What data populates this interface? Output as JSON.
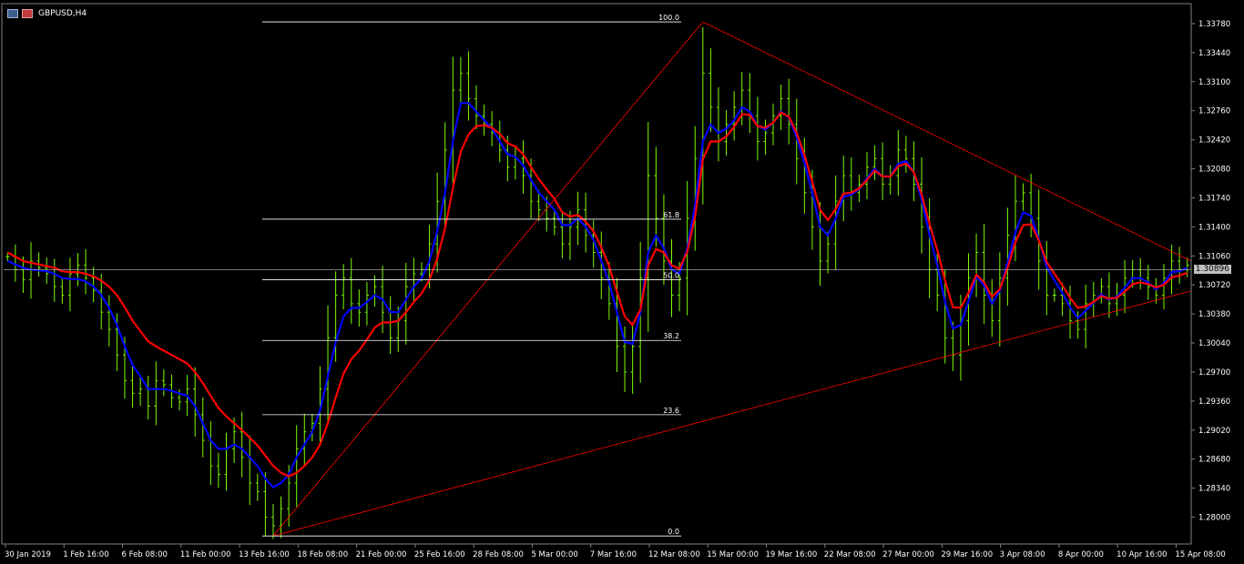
{
  "window": {
    "symbol_label": "GBPUSD,H4",
    "icons": [
      "chart-window-icon",
      "window-restore-icon"
    ]
  },
  "chart_data": {
    "type": "line",
    "style": "candlestick-bars",
    "symbol": "GBPUSD",
    "timeframe": "H4",
    "ylim": [
      1.2775,
      1.3395
    ],
    "y_ticks": [
      "1.33780",
      "1.33440",
      "1.33100",
      "1.32760",
      "1.32420",
      "1.32080",
      "1.31740",
      "1.31400",
      "1.31060",
      "1.30720",
      "1.30380",
      "1.30040",
      "1.29700",
      "1.29360",
      "1.29020",
      "1.28680",
      "1.28340",
      "1.28000"
    ],
    "x_ticks": [
      "30 Jan 2019",
      "1 Feb 16:00",
      "6 Feb 08:00",
      "11 Feb 00:00",
      "13 Feb 16:00",
      "18 Feb 08:00",
      "21 Feb 00:00",
      "25 Feb 16:00",
      "28 Feb 08:00",
      "5 Mar 00:00",
      "7 Mar 16:00",
      "12 Mar 08:00",
      "15 Mar 00:00",
      "19 Mar 16:00",
      "22 Mar 08:00",
      "27 Mar 00:00",
      "29 Mar 16:00",
      "3 Apr 08:00",
      "8 Apr 00:00",
      "10 Apr 16:00",
      "15 Apr 08:00"
    ],
    "current_price": "1.30896",
    "close": [
      1.3105,
      1.309,
      1.3078,
      1.31,
      1.3092,
      1.3085,
      1.307,
      1.306,
      1.3085,
      1.3095,
      1.308,
      1.3065,
      1.304,
      1.302,
      1.299,
      1.296,
      1.2945,
      1.295,
      1.293,
      1.296,
      1.2955,
      1.294,
      1.2935,
      1.295,
      1.292,
      1.289,
      1.286,
      1.285,
      1.288,
      1.29,
      1.287,
      1.284,
      1.283,
      1.28,
      1.279,
      1.281,
      1.284,
      1.288,
      1.29,
      1.291,
      1.295,
      1.301,
      1.306,
      1.308,
      1.305,
      1.304,
      1.306,
      1.307,
      1.304,
      1.301,
      1.303,
      1.307,
      1.3085,
      1.309,
      1.312,
      1.317,
      1.323,
      1.33,
      1.332,
      1.329,
      1.327,
      1.326,
      1.325,
      1.323,
      1.321,
      1.322,
      1.32,
      1.317,
      1.316,
      1.315,
      1.314,
      1.312,
      1.314,
      1.316,
      1.313,
      1.311,
      1.308,
      1.305,
      1.3,
      1.297,
      1.3,
      1.308,
      1.32,
      1.315,
      1.31,
      1.306,
      1.308,
      1.315,
      1.322,
      1.332,
      1.328,
      1.324,
      1.326,
      1.328,
      1.33,
      1.327,
      1.324,
      1.325,
      1.327,
      1.329,
      1.326,
      1.322,
      1.318,
      1.314,
      1.31,
      1.312,
      1.317,
      1.32,
      1.318,
      1.319,
      1.321,
      1.322,
      1.319,
      1.32,
      1.323,
      1.322,
      1.319,
      1.314,
      1.309,
      1.306,
      1.301,
      1.299,
      1.303,
      1.308,
      1.311,
      1.306,
      1.303,
      1.308,
      1.313,
      1.317,
      1.318,
      1.315,
      1.31,
      1.306,
      1.306,
      1.305,
      1.303,
      1.302,
      1.305,
      1.306,
      1.307,
      1.305,
      1.306,
      1.308,
      1.309,
      1.308,
      1.307,
      1.306,
      1.308,
      1.31,
      1.309,
      1.3095
    ],
    "series": [
      {
        "name": "",
        "color": "#0000ff",
        "values": [
          1.31,
          1.3096,
          1.3092,
          1.309,
          1.3089,
          1.3088,
          1.3085,
          1.308,
          1.3079,
          1.3079,
          1.3076,
          1.307,
          1.306,
          1.3045,
          1.3025,
          1.3,
          1.2978,
          1.2965,
          1.295,
          1.295,
          1.295,
          1.2948,
          1.2945,
          1.2942,
          1.293,
          1.291,
          1.289,
          1.288,
          1.288,
          1.2885,
          1.288,
          1.287,
          1.286,
          1.2845,
          1.2835,
          1.284,
          1.285,
          1.287,
          1.2885,
          1.29,
          1.2925,
          1.2965,
          1.3005,
          1.3035,
          1.3045,
          1.3045,
          1.3052,
          1.306,
          1.3055,
          1.304,
          1.304,
          1.3055,
          1.307,
          1.308,
          1.31,
          1.3135,
          1.318,
          1.324,
          1.3285,
          1.3285,
          1.3275,
          1.3265,
          1.3255,
          1.324,
          1.3225,
          1.3222,
          1.3212,
          1.3195,
          1.318,
          1.317,
          1.316,
          1.3142,
          1.3142,
          1.315,
          1.314,
          1.3125,
          1.31,
          1.3075,
          1.304,
          1.3005,
          1.3003,
          1.304,
          1.311,
          1.313,
          1.3115,
          1.309,
          1.3085,
          1.3115,
          1.3165,
          1.324,
          1.326,
          1.325,
          1.3255,
          1.3265,
          1.328,
          1.3275,
          1.3258,
          1.3254,
          1.3262,
          1.3275,
          1.3268,
          1.3245,
          1.3215,
          1.318,
          1.314,
          1.313,
          1.315,
          1.3175,
          1.3178,
          1.3184,
          1.3197,
          1.3208,
          1.3199,
          1.3199,
          1.3214,
          1.3217,
          1.3204,
          1.3172,
          1.3131,
          1.3095,
          1.3052,
          1.3021,
          1.3025,
          1.3053,
          1.3082,
          1.3071,
          1.305,
          1.3065,
          1.3098,
          1.3134,
          1.3157,
          1.3153,
          1.3126,
          1.3093,
          1.3077,
          1.3063,
          1.3046,
          1.3033,
          1.3042,
          1.3051,
          1.3061,
          1.3055,
          1.3058,
          1.3069,
          1.308,
          1.308,
          1.3075,
          1.3067,
          1.3074,
          1.3087,
          1.3088,
          1.3092
        ]
      },
      {
        "name": "",
        "color": "#ff0000",
        "values": [
          1.311,
          1.3105,
          1.31,
          1.3098,
          1.3096,
          1.3094,
          1.3092,
          1.3088,
          1.3087,
          1.3087,
          1.3085,
          1.3082,
          1.3077,
          1.307,
          1.306,
          1.3046,
          1.303,
          1.3018,
          1.3006,
          1.3,
          1.2995,
          1.299,
          1.2985,
          1.298,
          1.297,
          1.2957,
          1.2942,
          1.2928,
          1.2918,
          1.291,
          1.2902,
          1.2893,
          1.2884,
          1.2872,
          1.286,
          1.2852,
          1.2848,
          1.2852,
          1.286,
          1.287,
          1.2885,
          1.291,
          1.294,
          1.2968,
          1.2985,
          1.2995,
          1.3008,
          1.3022,
          1.3028,
          1.3028,
          1.303,
          1.304,
          1.3052,
          1.3062,
          1.3078,
          1.3103,
          1.3138,
          1.3185,
          1.3228,
          1.3248,
          1.3258,
          1.3259,
          1.3256,
          1.3249,
          1.3238,
          1.3234,
          1.3225,
          1.321,
          1.3196,
          1.3184,
          1.3173,
          1.3157,
          1.3152,
          1.3154,
          1.3146,
          1.3135,
          1.3116,
          1.3094,
          1.3064,
          1.3035,
          1.3025,
          1.3043,
          1.3095,
          1.3114,
          1.311,
          1.3095,
          1.3091,
          1.3111,
          1.3152,
          1.3219,
          1.324,
          1.324,
          1.3246,
          1.3257,
          1.3272,
          1.3271,
          1.3258,
          1.3256,
          1.3262,
          1.3274,
          1.3269,
          1.325,
          1.3224,
          1.3193,
          1.316,
          1.3148,
          1.3161,
          1.3179,
          1.318,
          1.3185,
          1.3195,
          1.3206,
          1.3199,
          1.3199,
          1.3211,
          1.3214,
          1.3204,
          1.3178,
          1.3144,
          1.3113,
          1.3077,
          1.3046,
          1.3045,
          1.3063,
          1.3084,
          1.3075,
          1.3058,
          1.3067,
          1.3092,
          1.3122,
          1.3142,
          1.3143,
          1.3124,
          1.3099,
          1.3085,
          1.3072,
          1.3057,
          1.3045,
          1.3047,
          1.3052,
          1.3059,
          1.3056,
          1.3057,
          1.3064,
          1.3073,
          1.3075,
          1.3073,
          1.3069,
          1.3072,
          1.3081,
          1.3083,
          1.3086
        ]
      }
    ],
    "fibonacci": {
      "levels": [
        {
          "label": "100.0",
          "price": 1.338
        },
        {
          "label": "61.8",
          "price": 1.3149
        },
        {
          "label": "50.0",
          "price": 1.3078
        },
        {
          "label": "38.2",
          "price": 1.3007
        },
        {
          "label": "23.6",
          "price": 1.292
        },
        {
          "label": "0.0",
          "price": 1.2778
        }
      ]
    },
    "title": "",
    "xlabel": "",
    "ylabel": "",
    "grid": false
  }
}
